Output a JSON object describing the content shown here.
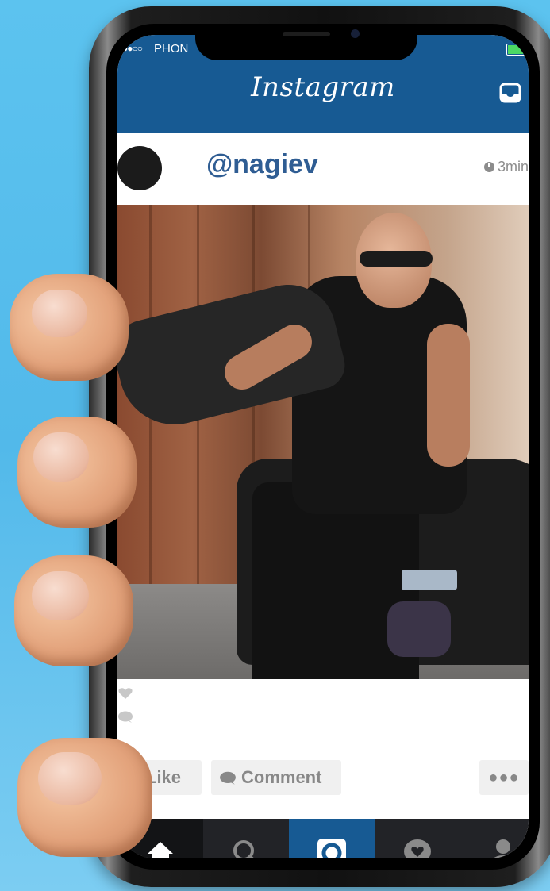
{
  "status_bar": {
    "signal": "●●○○",
    "carrier": "PHON"
  },
  "header": {
    "logo": "Instagram"
  },
  "post": {
    "username": "@nagiev",
    "time": "3min"
  },
  "actions": {
    "like_label": "Like",
    "comment_label": "Comment",
    "more_label": "●●●"
  },
  "tabbar": {
    "items": [
      "home-icon",
      "search-icon",
      "camera-icon",
      "activity-icon",
      "profile-icon"
    ],
    "active": "camera-icon"
  },
  "colors": {
    "brand_blue": "#175a93",
    "tabbar_bg": "#222327",
    "username": "#2f5d93",
    "background": "#5cc3ef"
  }
}
